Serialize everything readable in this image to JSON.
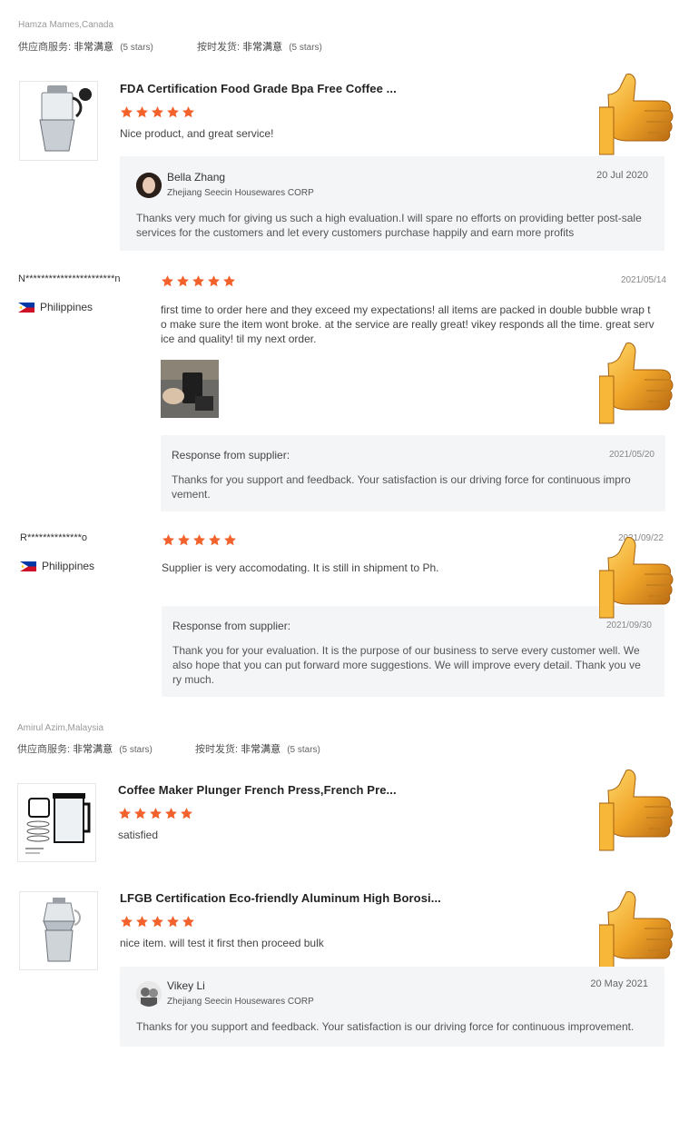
{
  "colors": {
    "star": "#f3622c",
    "reply_bg": "#f4f5f7",
    "border": "#e6e6e6"
  },
  "group1": {
    "buyer": "Hamza Mames,Canada",
    "svc_label": "供应商服务:",
    "svc_value": "非常满意",
    "svc_stars": "(5 stars)",
    "ship_label": "按时发货:",
    "ship_value": "非常满意",
    "ship_stars": "(5 stars)",
    "product": {
      "title": "FDA Certification Food Grade Bpa Free Coffee ...",
      "rating": 5,
      "comment": "Nice product, and great service!",
      "image_icon": "moka-pot-icon"
    },
    "reply": {
      "name": "Bella Zhang",
      "company": "Zhejiang Seecin Housewares CORP",
      "date": "20 Jul 2020",
      "text": "Thanks very much for giving us such a high evaluation.I will spare no efforts on providing better post-sale services for the customers and let every customers purchase happily and earn more profits"
    }
  },
  "review2": {
    "buyer": "N***********************n",
    "country": "Philippines",
    "rating": 5,
    "date": "2021/05/14",
    "text_lines": [
      "first time to order here and they exceed my expectations! all items are packed in double bubble wrap t",
      "o make sure the item wont broke. at the service are really great! vikey responds all the time. great serv",
      "ice and quality! til my next order."
    ],
    "photo_icon": "review-photo-icon",
    "response_label": "Response from supplier:",
    "response_date": "2021/05/20",
    "response_lines": [
      "Thanks for you support and feedback. Your satisfaction is our driving force for continuous impro",
      "vement."
    ]
  },
  "review3": {
    "buyer": "R**************o",
    "country": "Philippines",
    "rating": 5,
    "date": "2021/09/22",
    "text": "Supplier is very accomodating. It is still in shipment to Ph.",
    "response_label": "Response from supplier:",
    "response_date": "2021/09/30",
    "response_lines": [
      "Thank you for your evaluation. It is the purpose of our business to serve every customer well. We",
      "also hope that you can put forward more suggestions. We will improve every detail. Thank you ve",
      "ry much."
    ]
  },
  "group2": {
    "buyer": "Amirul Azim,Malaysia",
    "svc_label": "供应商服务:",
    "svc_value": "非常满意",
    "svc_stars": "(5 stars)",
    "ship_label": "按时发货:",
    "ship_value": "非常满意",
    "ship_stars": "(5 stars)",
    "product1": {
      "title": "Coffee Maker Plunger French Press,French Pre...",
      "rating": 5,
      "comment": "satisfied",
      "image_icon": "french-press-icon"
    },
    "product2": {
      "title": "LFGB Certification Eco-friendly Aluminum High Borosi...",
      "rating": 5,
      "comment": "nice item. will test it first then proceed bulk",
      "image_icon": "glass-moka-pot-icon"
    },
    "reply": {
      "name": "Vikey Li",
      "company": "Zhejiang Seecin Housewares CORP",
      "date": "20 May 2021",
      "text": "Thanks for you support and feedback. Your satisfaction is our driving force for continuous improvement."
    }
  },
  "decor": {
    "thumbs_icon": "thumbs-up-icon"
  }
}
